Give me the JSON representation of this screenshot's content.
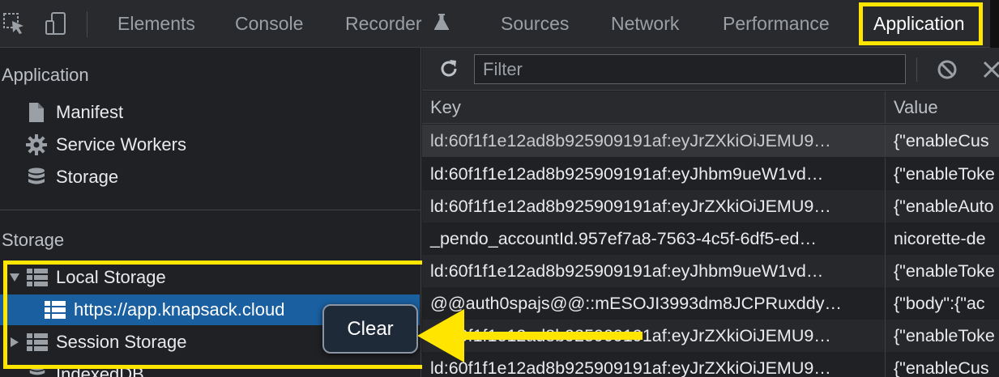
{
  "devtools": {
    "tabs": [
      {
        "label": "Elements"
      },
      {
        "label": "Console"
      },
      {
        "label": "Recorder"
      },
      {
        "label": "Sources"
      },
      {
        "label": "Network"
      },
      {
        "label": "Performance"
      },
      {
        "label": "Application"
      }
    ],
    "active_tab": "Application",
    "highlight_color": "#ffe500"
  },
  "sidebar": {
    "application_title": "Application",
    "application_items": [
      {
        "label": "Manifest",
        "icon": "document-icon"
      },
      {
        "label": "Service Workers",
        "icon": "gear-icon"
      },
      {
        "label": "Storage",
        "icon": "database-icon"
      }
    ],
    "storage_title": "Storage",
    "storage_tree": [
      {
        "label": "Local Storage",
        "icon": "table-grid-icon",
        "expanded": true
      },
      {
        "label": "https://app.knapsack.cloud",
        "icon": "table-grid-icon",
        "selected": true
      },
      {
        "label": "Session Storage",
        "icon": "table-grid-icon",
        "expanded": false
      },
      {
        "label": "IndexedDB",
        "icon": "database-icon"
      }
    ],
    "selected_color": "#1a5fa0"
  },
  "toolbar": {
    "filter_placeholder": "Filter"
  },
  "table": {
    "key_header": "Key",
    "value_header": "Value",
    "rows": [
      {
        "key": "ld:60f1f1e12ad8b925909191af:eyJrZXkiOiJEMU9…",
        "value": "{\"enableCus"
      },
      {
        "key": "ld:60f1f1e12ad8b925909191af:eyJhbm9ueW1vd…",
        "value": "{\"enableToke"
      },
      {
        "key": "ld:60f1f1e12ad8b925909191af:eyJrZXkiOiJEMU9…",
        "value": "{\"enableAuto"
      },
      {
        "key": "_pendo_accountId.957ef7a8-7563-4c5f-6df5-ed…",
        "value": "nicorette-de"
      },
      {
        "key": "ld:60f1f1e12ad8b925909191af:eyJhbm9ueW1vd…",
        "value": "{\"enableToke"
      },
      {
        "key": "@@auth0spajs@@::mESOJI3993dm8JCPRuxddy…",
        "value": "{\"body\":{\"ac"
      },
      {
        "key": "ld:60f1f1e12ad8b925909191af:eyJrZXkiOiJEMU9…",
        "value": "{\"enableToke"
      },
      {
        "key": "ld:60f1f1e12ad8b925909191af:eyJrZXkiOiJEMU9…",
        "value": "{\"enableCus"
      }
    ]
  },
  "context_menu": {
    "clear_label": "Clear"
  }
}
